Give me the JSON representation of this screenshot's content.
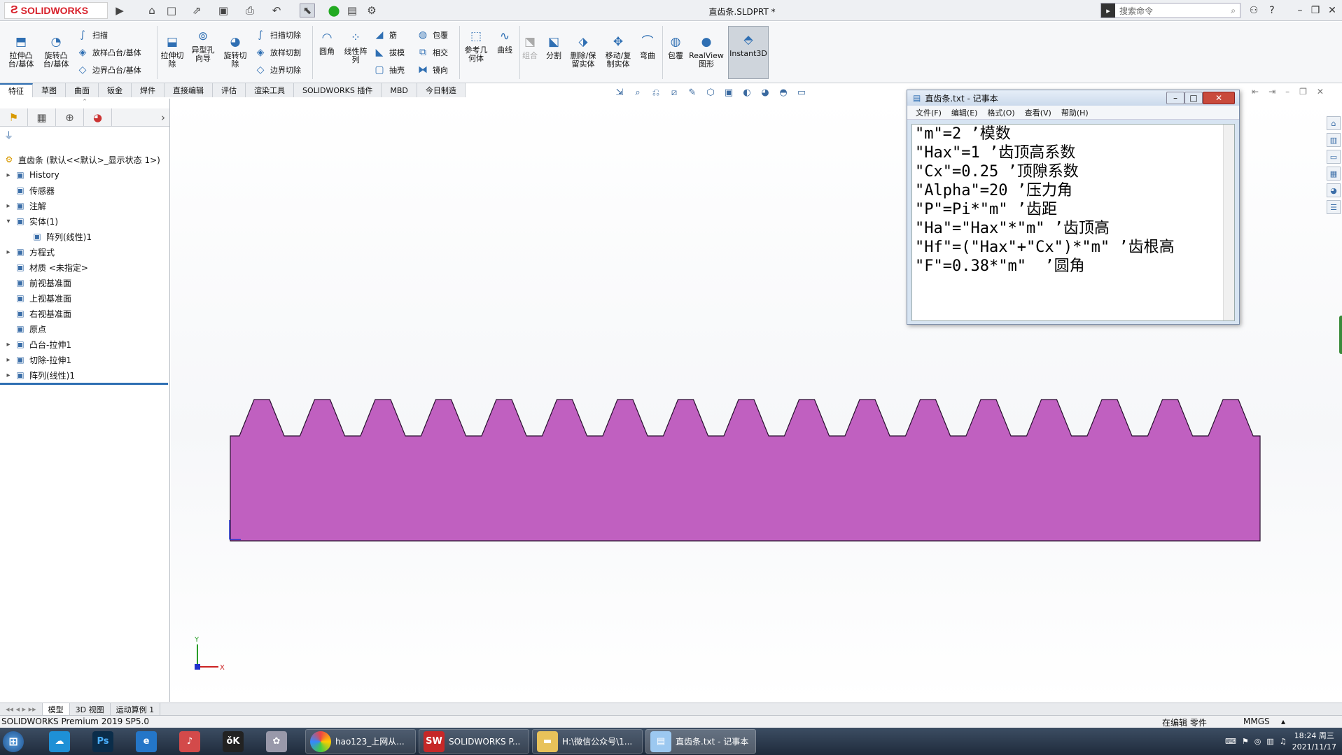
{
  "app": {
    "brand": "SOLIDWORKS",
    "doc_title": "直齿条.SLDPRT *",
    "search_placeholder": "搜索命令"
  },
  "qa_icons": [
    "home-icon",
    "new-file-icon",
    "open-icon",
    "save-icon",
    "print-icon",
    "undo-icon",
    "select-icon",
    "rebuild-icon",
    "file-properties-icon",
    "options-icon"
  ],
  "ribbon": {
    "extrude_boss": "拉伸凸\n台/基体",
    "revolve_boss": "旋转凸\n台/基体",
    "sweep": "扫描",
    "loft_boss": "放样凸台/基体",
    "boundary_boss": "边界凸台/基体",
    "extrude_cut": "拉伸切\n除",
    "hole_wizard": "异型孔\n向导",
    "revolve_cut": "旋转切\n除",
    "swept_cut": "扫描切除",
    "lofted_cut": "放样切割",
    "boundary_cut": "边界切除",
    "fillet": "圆角",
    "linear_pattern": "线性阵\n列",
    "rib": "筋",
    "draft": "拔模",
    "shell": "抽壳",
    "wrap": "包覆",
    "intersect": "相交",
    "mirror": "镜向",
    "ref_geometry": "参考几\n何体",
    "curves": "曲线",
    "combine": "组合",
    "split": "分割",
    "delete_keep_body": "删除/保\n留实体",
    "move_copy_body": "移动/复\n制实体",
    "flex": "弯曲",
    "wrap2": "包覆",
    "realview": "RealView\n图形",
    "instant3d": "Instant3D"
  },
  "tabs": [
    "特征",
    "草图",
    "曲面",
    "钣金",
    "焊件",
    "直接编辑",
    "评估",
    "渲染工具",
    "SOLIDWORKS 插件",
    "MBD",
    "今日制造"
  ],
  "tree": {
    "root": "直齿条  (默认<<默认>_显示状态 1>)",
    "items": [
      {
        "label": "History",
        "icon": "history-icon",
        "expand": "▸"
      },
      {
        "label": "传感器",
        "icon": "sensor-icon",
        "expand": ""
      },
      {
        "label": "注解",
        "icon": "annotation-icon",
        "expand": "▸"
      },
      {
        "label": "实体(1)",
        "icon": "solid-bodies-icon",
        "expand": "▾"
      },
      {
        "label": "阵列(线性)1",
        "icon": "body-icon",
        "expand": "",
        "indent": 1
      },
      {
        "label": "方程式",
        "icon": "equations-icon",
        "expand": "▸"
      },
      {
        "label": "材质 <未指定>",
        "icon": "material-icon",
        "expand": ""
      },
      {
        "label": "前视基准面",
        "icon": "plane-icon",
        "expand": ""
      },
      {
        "label": "上视基准面",
        "icon": "plane-icon",
        "expand": ""
      },
      {
        "label": "右视基准面",
        "icon": "plane-icon",
        "expand": ""
      },
      {
        "label": "原点",
        "icon": "origin-icon",
        "expand": ""
      },
      {
        "label": "凸台-拉伸1",
        "icon": "extrude-boss-icon",
        "expand": "▸"
      },
      {
        "label": "切除-拉伸1",
        "icon": "extrude-cut-icon",
        "expand": "▸"
      },
      {
        "label": "阵列(线性)1",
        "icon": "linear-pattern-icon",
        "expand": "▸"
      }
    ]
  },
  "notepad": {
    "title": "直齿条.txt - 记事本",
    "menu": [
      "文件(F)",
      "编辑(E)",
      "格式(O)",
      "查看(V)",
      "帮助(H)"
    ],
    "lines": [
      "\"m\"=2 ’模数",
      "\"Hax\"=1 ’齿顶高系数",
      "\"Cx\"=0.25 ’顶隙系数",
      "\"Alpha\"=20 ’压力角",
      "\"P\"=Pi*\"m\" ’齿距",
      "\"Ha\"=\"Hax\"*\"m\" ’齿顶高",
      "\"Hf\"=(\"Hax\"+\"Cx\")*\"m\" ’齿根高",
      "\"F\"=0.38*\"m\"  ’圆角"
    ]
  },
  "model": {
    "color": "#c060c0",
    "teeth": 17
  },
  "axis": {
    "y": "Y",
    "x": "X"
  },
  "bottom_tabs": [
    "模型",
    "3D 视图",
    "运动算例 1"
  ],
  "status": {
    "left": "SOLIDWORKS Premium 2019 SP5.0",
    "editing": "在编辑 零件",
    "units": "MMGS"
  },
  "taskbar": {
    "apps": [
      "hao123_上网从...",
      "SOLIDWORKS P...",
      "H:\\微信公众号\\1...",
      "直齿条.txt - 记事本"
    ],
    "time": "18:24 周三",
    "date": "2021/11/17"
  }
}
